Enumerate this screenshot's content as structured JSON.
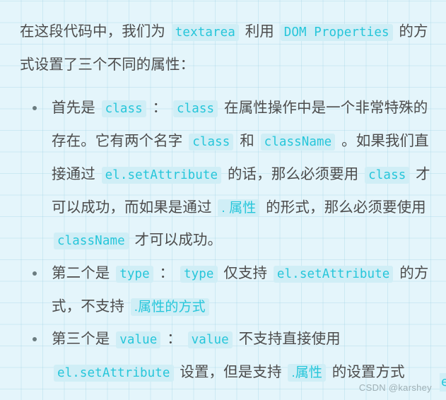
{
  "page": {
    "background_color": "#e4f5fb",
    "grid_line_color": "#96cde1",
    "text_color": "#4c4c4c",
    "code_text_color": "#26c6da",
    "code_bg_color": "#d0eef6"
  },
  "intro": {
    "seg1": "在这段代码中，我们为",
    "code1": "textarea",
    "seg2": "利用",
    "code2": "DOM Properties",
    "seg3": "的方式设置了三个不同的属性："
  },
  "bullets": [
    {
      "seg1": "首先是",
      "code1": "class",
      "seg2": "：",
      "code2": "class",
      "seg3": "在属性操作中是一个非常特殊的存在。它有两个名字",
      "code3": "class",
      "seg4": "和",
      "code4": "className",
      "seg5": "。如果我们直接通过",
      "code5": "el.setAttribute",
      "seg6": "的话，那么必须要用",
      "code6": "class",
      "seg7": "才可以成功，而如果是通过",
      "code7": ". 属性",
      "seg8": "的形式，那么必须要使用",
      "code8": "className",
      "seg9": "才可以成功。"
    },
    {
      "seg1": "第二个是",
      "code1": "type",
      "seg2": "：",
      "code2": "type",
      "seg3": "仅支持",
      "code3": "el.setAttribute",
      "seg4": "的方式，不支持",
      "code4": ".属性的方式"
    },
    {
      "seg1": "第三个是",
      "code1": "value",
      "seg2": "：",
      "code2": "value",
      "seg3": "不支持直接使用",
      "code3": "el.setAttribute",
      "seg4": "设置，但是支持",
      "code4": ".属性",
      "seg5": "的设置方式"
    }
  ],
  "watermark": {
    "text": "CSDN @karshey"
  },
  "edge_clip": {
    "text": "el"
  }
}
